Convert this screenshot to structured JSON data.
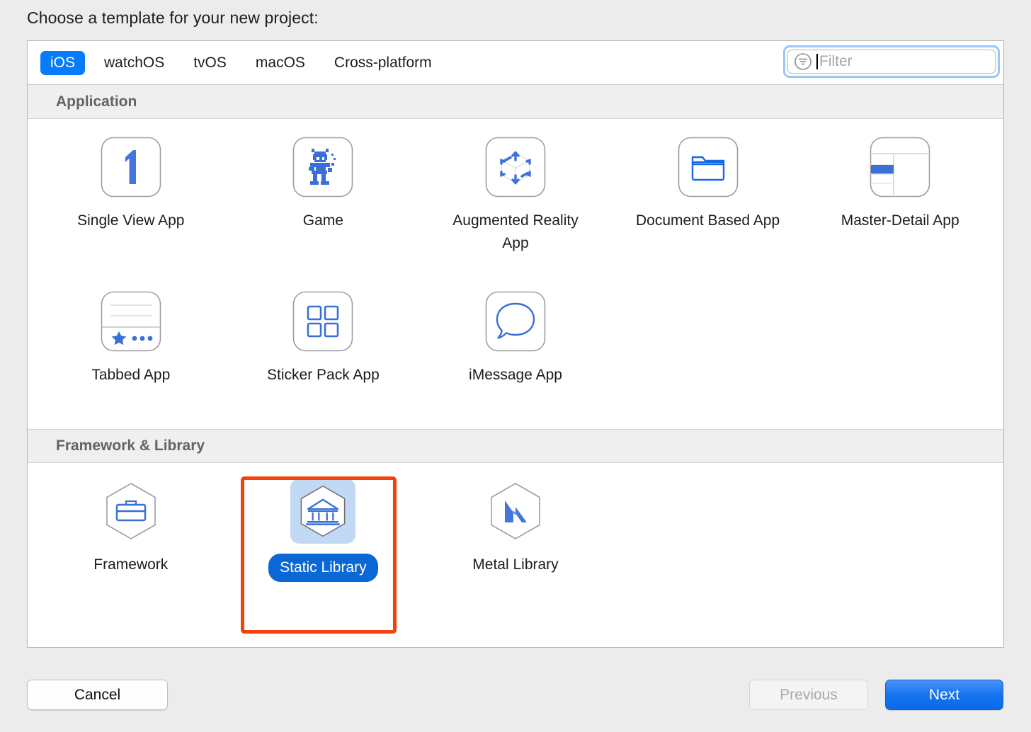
{
  "prompt": "Choose a template for your new project:",
  "tabs": [
    {
      "label": "iOS",
      "active": true
    },
    {
      "label": "watchOS",
      "active": false
    },
    {
      "label": "tvOS",
      "active": false
    },
    {
      "label": "macOS",
      "active": false
    },
    {
      "label": "Cross-platform",
      "active": false
    }
  ],
  "filter": {
    "placeholder": "Filter",
    "value": "",
    "icon": "filter-icon",
    "focused": true
  },
  "sections": [
    {
      "title": "Application",
      "templates": [
        {
          "label": "Single View App",
          "icon": "number-one-icon",
          "selected": false
        },
        {
          "label": "Game",
          "icon": "pixel-robot-icon",
          "selected": false
        },
        {
          "label": "Augmented Reality App",
          "icon": "ar-cube-icon",
          "selected": false
        },
        {
          "label": "Document Based App",
          "icon": "folder-icon",
          "selected": false
        },
        {
          "label": "Master-Detail App",
          "icon": "split-view-icon",
          "selected": false
        },
        {
          "label": "Tabbed App",
          "icon": "tabbar-star-icon",
          "selected": false
        },
        {
          "label": "Sticker Pack App",
          "icon": "four-squares-icon",
          "selected": false
        },
        {
          "label": "iMessage App",
          "icon": "speech-bubble-icon",
          "selected": false
        }
      ]
    },
    {
      "title": "Framework & Library",
      "templates": [
        {
          "label": "Framework",
          "icon": "hexagon-toolbox-icon",
          "selected": false
        },
        {
          "label": "Static Library",
          "icon": "hexagon-bank-icon",
          "selected": true
        },
        {
          "label": "Metal Library",
          "icon": "hexagon-metal-m-icon",
          "selected": false
        }
      ]
    }
  ],
  "footer": {
    "cancel_label": "Cancel",
    "previous_label": "Previous",
    "previous_disabled": true,
    "next_label": "Next"
  },
  "colors": {
    "accent_blue": "#067cfb",
    "selection_blue": "#0a68d6",
    "selection_icon_bg": "#c1d9f4",
    "annotation_orange": "#f4420d",
    "icon_blue": "#4276dd",
    "panel_bg": "#ffffff",
    "window_bg": "#ececec"
  }
}
